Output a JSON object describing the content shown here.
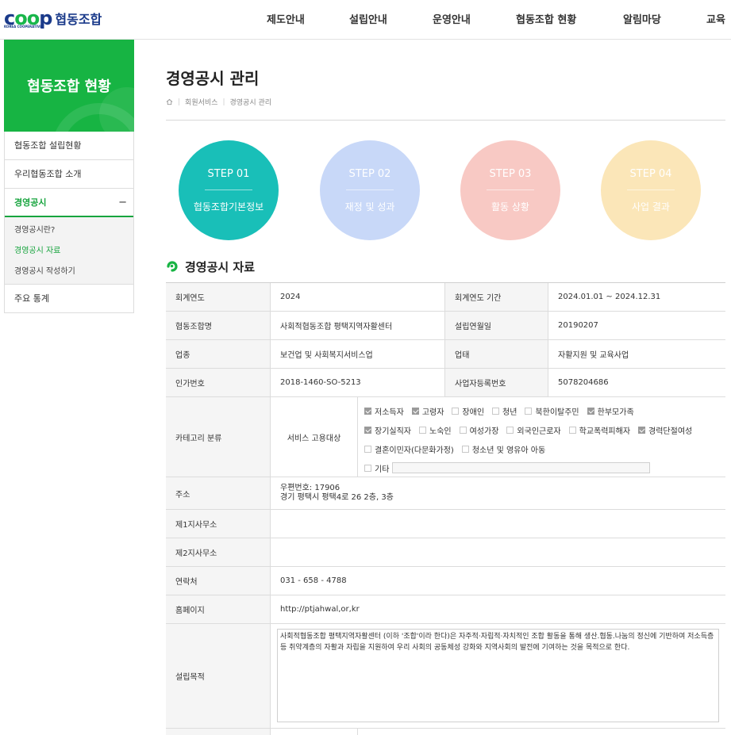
{
  "header": {
    "logo_text": "coop",
    "logo_sub": "KOREA COOPERATIVES",
    "brand": "협동조합",
    "nav": [
      "제도안내",
      "설립안내",
      "운영안내",
      "협동조합 현황",
      "알림마당",
      "교육"
    ]
  },
  "sidebar": {
    "title": "협동조합 현황",
    "items": [
      "협동조합 설립현황",
      "우리협동조합 소개",
      "경영공시",
      "주요 통계"
    ],
    "sub_items": [
      "경영공시란?",
      "경영공시 자료",
      "경영공시 작성하기"
    ],
    "collapse_symbol": "−"
  },
  "page": {
    "title": "경영공시 관리",
    "breadcrumb": [
      "회원서비스",
      "경영공시 관리"
    ]
  },
  "steps": [
    {
      "num": "STEP 01",
      "label": "협동조합기본정보",
      "color": "#19bfb8"
    },
    {
      "num": "STEP 02",
      "label": "재정 및 성과",
      "color": "#c8d8f8"
    },
    {
      "num": "STEP 03",
      "label": "활동 상황",
      "color": "#f8c9c4"
    },
    {
      "num": "STEP 04",
      "label": "사업 결과",
      "color": "#fbe6b8"
    }
  ],
  "section": {
    "title": "경영공시 자료"
  },
  "table": {
    "fiscal_year_label": "회계연도",
    "fiscal_year": "2024",
    "fiscal_period_label": "회계연도 기간",
    "fiscal_period": "2024.01.01 ~ 2024.12.31",
    "coop_name_label": "협동조합명",
    "coop_name": "사회적협동조합 평택지역자활센터",
    "founded_label": "설립연월일",
    "founded": "20190207",
    "industry_label": "업종",
    "industry": "보건업 및 사회복지서비스업",
    "business_label": "업태",
    "business": "자활지원 및 교육사업",
    "license_label": "인가번호",
    "license": "2018-1460-SO-5213",
    "bizno_label": "사업자등록번호",
    "bizno": "5078204686",
    "category_label": "카테고리 분류",
    "category_sub": "서비스 고용대상",
    "checkboxes": [
      [
        {
          "label": "저소득자",
          "checked": true
        },
        {
          "label": "고령자",
          "checked": true
        },
        {
          "label": "장애인",
          "checked": false
        },
        {
          "label": "청년",
          "checked": false
        },
        {
          "label": "북한이탈주민",
          "checked": false
        },
        {
          "label": "한부모가족",
          "checked": true
        }
      ],
      [
        {
          "label": "장기실직자",
          "checked": true
        },
        {
          "label": "노숙인",
          "checked": false
        },
        {
          "label": "여성가장",
          "checked": false
        },
        {
          "label": "외국인근로자",
          "checked": false
        },
        {
          "label": "학교폭력피해자",
          "checked": false
        },
        {
          "label": "경력단절여성",
          "checked": true
        }
      ],
      [
        {
          "label": "결혼이민자(다문화가정)",
          "checked": false
        },
        {
          "label": "청소년 및 영유아 아동",
          "checked": false
        }
      ],
      [
        {
          "label": "기타",
          "checked": false
        }
      ]
    ],
    "address_label": "주소",
    "address_zip": "우편번호: 17906",
    "address": "경기 평택시 평택4로 26  2층, 3층",
    "branch1_label": "제1지사무소",
    "branch1": "",
    "branch2_label": "제2지사무소",
    "branch2": "",
    "contact_label": "연락처",
    "contact": "031 - 658 - 4788",
    "homepage_label": "홈페이지",
    "homepage": "http://ptjahwal,or,kr",
    "purpose_label": "설립목적",
    "purpose": "사회적협동조합 평택지역자활센터 (이하 '조합'이라 한다)은 자주적·자립적·자치적인 조합 활동을 통해 생산.협동.나눔의 정신에 기반하여 저소득층 등 취약계층의 자활과 자립을 지원하여 우리 사회의 공동체성 강화와 지역사회의 발전에 기여하는 것을 목적으로 한다."
  }
}
